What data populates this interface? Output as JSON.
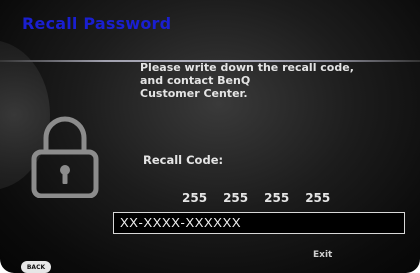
{
  "dialog": {
    "title": "Recall Password",
    "message_lines": [
      "Please write down the recall code,",
      "and contact BenQ",
      "Customer Center."
    ],
    "recall_label": "Recall Code:",
    "recall_codes": [
      "255",
      "255",
      "255",
      "255"
    ],
    "code_value": "XX-XXXX-XXXXXX",
    "exit_label": "Exit",
    "back_label": "BACK"
  },
  "colors": {
    "title": "#1a1fd0",
    "text": "#e4e4e4",
    "background": "#1c1c1c",
    "field_border": "#d8d8d8"
  },
  "icons": {
    "lock": "padlock-icon"
  }
}
